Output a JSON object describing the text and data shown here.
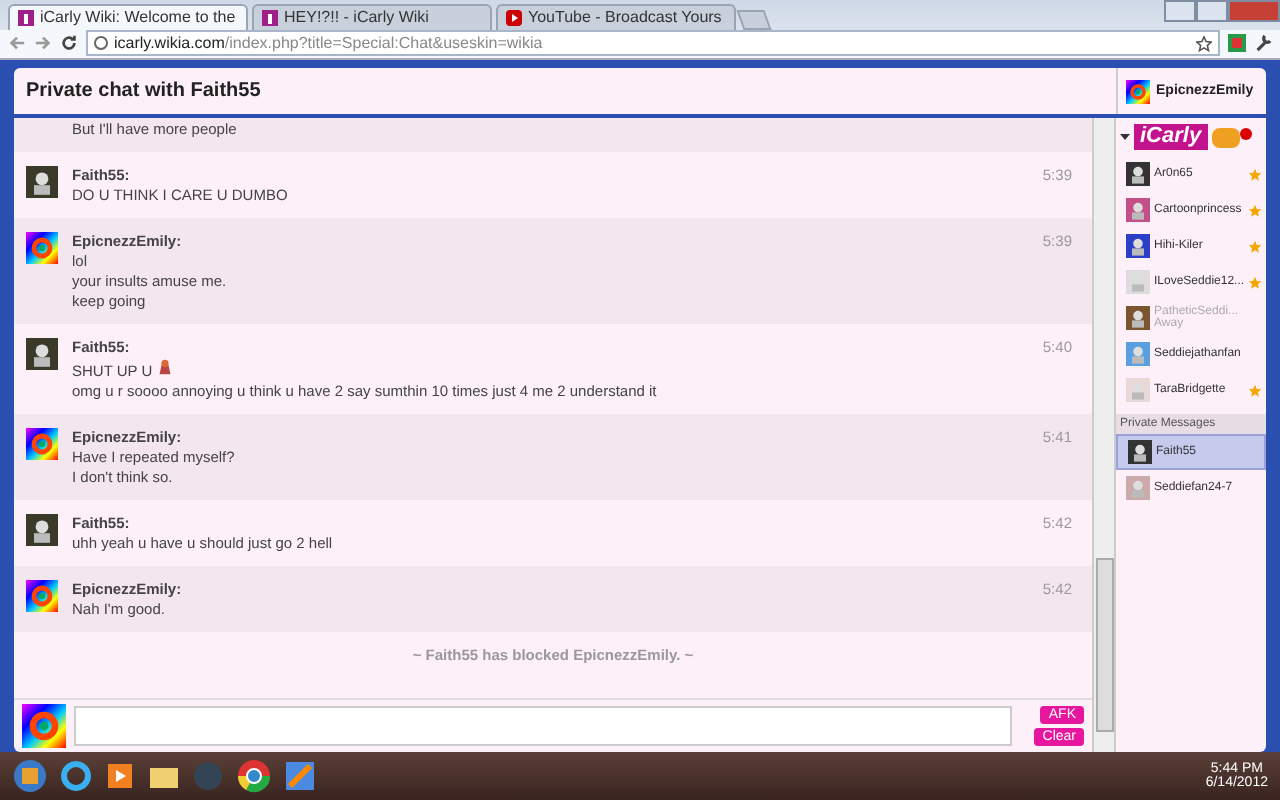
{
  "browser": {
    "tabs": [
      {
        "label": "iCarly Wiki: Welcome to the",
        "selected": true,
        "kind": "wiki"
      },
      {
        "label": "HEY!?!! - iCarly Wiki",
        "selected": false,
        "kind": "wiki"
      },
      {
        "label": "YouTube - Broadcast Yours",
        "selected": false,
        "kind": "video"
      }
    ],
    "address": {
      "host": "icarly.wikia.com",
      "path": "/index.php?title=Special:Chat&useskin=wikia"
    }
  },
  "chat": {
    "title": "Private chat with Faith55",
    "current_user": "EpicnezzEmily",
    "messages": [
      {
        "kind": "self",
        "lines": [
          "But I'll have more people"
        ]
      },
      {
        "kind": "other",
        "user": "Faith55:",
        "lines": [
          "DO U THINK I CARE U DUMBO"
        ],
        "time": "5:39"
      },
      {
        "kind": "self",
        "user": "EpicnezzEmily:",
        "lines": [
          "lol",
          "your insults amuse me.",
          "keep going"
        ],
        "time": "5:39"
      },
      {
        "kind": "other",
        "user": "Faith55:",
        "lines": [
          "SHUT UP U",
          "omg u r soooo annoying u think u have 2 say sumthin 10 times just 4 me 2 understand it"
        ],
        "time": "5:40",
        "emoticon": true
      },
      {
        "kind": "self",
        "user": "EpicnezzEmily:",
        "lines": [
          "Have I repeated myself?",
          "I don't think so."
        ],
        "time": "5:41"
      },
      {
        "kind": "other",
        "user": "Faith55:",
        "lines": [
          "uhh yeah u have u should just go 2 hell"
        ],
        "time": "5:42"
      },
      {
        "kind": "self",
        "user": "EpicnezzEmily:",
        "lines": [
          "Nah I'm good."
        ],
        "time": "5:42"
      }
    ],
    "notice": "~ Faith55 has blocked EpicnezzEmily. ~",
    "buttons": [
      "AFK",
      "Clear"
    ]
  },
  "sidebar": {
    "logo": "iCarly",
    "users": [
      {
        "name": "Ar0n65",
        "starred": true,
        "away": false
      },
      {
        "name": "Cartoonprincess",
        "starred": true,
        "away": false
      },
      {
        "name": "Hihi-Kiler",
        "starred": true,
        "away": false
      },
      {
        "name": "ILoveSeddie12...",
        "starred": true,
        "away": false
      },
      {
        "name": "PatheticSeddi...",
        "starred": false,
        "away": true,
        "status": "Away"
      },
      {
        "name": "Seddiejathanfan",
        "starred": false,
        "away": false
      },
      {
        "name": "TaraBridgette",
        "starred": true,
        "away": false
      }
    ],
    "private_heading": "Private Messages",
    "private": [
      {
        "name": "Faith55",
        "selected": true
      },
      {
        "name": "Seddiefan24-7",
        "selected": false
      }
    ]
  },
  "taskbar": {
    "time": "5:44 PM",
    "date": "6/14/2012"
  }
}
